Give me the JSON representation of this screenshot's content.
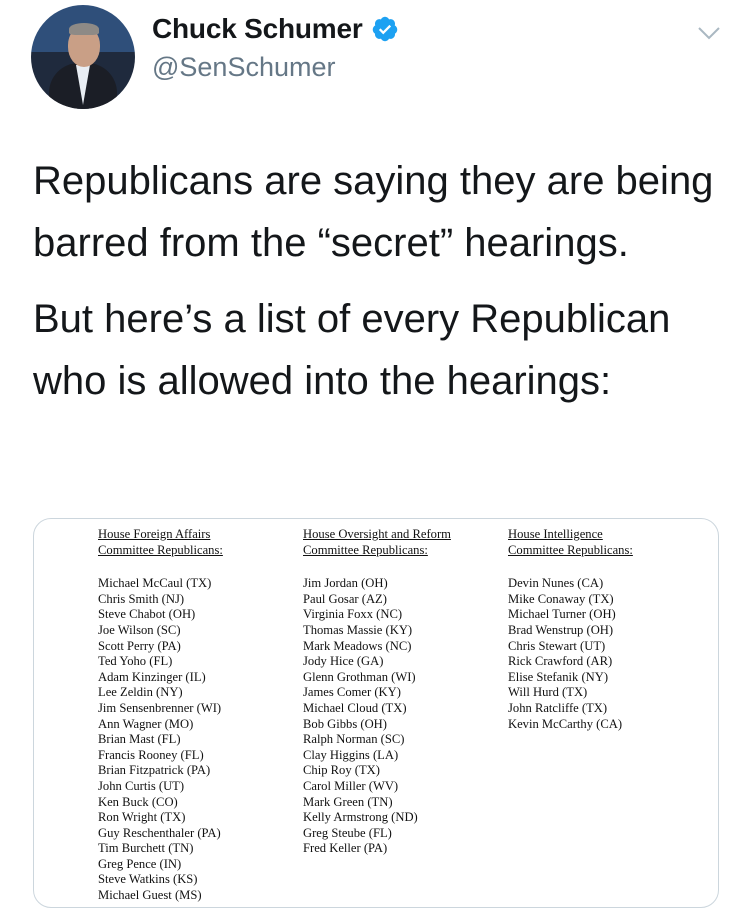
{
  "header": {
    "display_name": "Chuck Schumer",
    "handle": "@SenSchumer",
    "verified_icon": "verified-badge-icon",
    "more_icon": "chevron-down-icon",
    "accent_color": "#1da1f2"
  },
  "tweet": {
    "paragraph1": "Republicans are saying they are being barred from the “secret” hearings.",
    "paragraph2": "But here’s a list of every Republican who is allowed into the hearings:"
  },
  "image": {
    "columns": [
      {
        "header_line1": "House Foreign Affairs",
        "header_line2": "Committee Republicans:",
        "names": [
          "Michael McCaul (TX)",
          "Chris Smith (NJ)",
          "Steve Chabot (OH)",
          "Joe Wilson (SC)",
          "Scott Perry (PA)",
          "Ted Yoho (FL)",
          "Adam Kinzinger (IL)",
          "Lee Zeldin (NY)",
          "Jim Sensenbrenner (WI)",
          "Ann Wagner (MO)",
          "Brian Mast (FL)",
          "Francis Rooney (FL)",
          "Brian Fitzpatrick (PA)",
          "John Curtis (UT)",
          "Ken Buck (CO)",
          "Ron Wright (TX)",
          "Guy Reschenthaler (PA)",
          "Tim Burchett (TN)",
          "Greg Pence (IN)",
          "Steve Watkins (KS)",
          "Michael Guest (MS)"
        ]
      },
      {
        "header_line1": "House Oversight and Reform",
        "header_line2": "Committee Republicans:",
        "names": [
          "Jim Jordan (OH)",
          "Paul Gosar (AZ)",
          "Virginia Foxx (NC)",
          "Thomas Massie (KY)",
          "Mark Meadows (NC)",
          "Jody Hice (GA)",
          "Glenn Grothman (WI)",
          "James Comer (KY)",
          "Michael Cloud (TX)",
          "Bob Gibbs (OH)",
          "Ralph Norman (SC)",
          "Clay Higgins (LA)",
          "Chip Roy (TX)",
          "Carol Miller (WV)",
          "Mark Green (TN)",
          "Kelly Armstrong (ND)",
          "Greg Steube (FL)",
          "Fred Keller (PA)"
        ]
      },
      {
        "header_line1": "House Intelligence",
        "header_line2": "Committee Republicans:",
        "names": [
          "Devin Nunes (CA)",
          "Mike Conaway (TX)",
          "Michael Turner (OH)",
          "Brad Wenstrup (OH)",
          "Chris Stewart (UT)",
          "Rick Crawford (AR)",
          "Elise Stefanik (NY)",
          "Will Hurd (TX)",
          "John Ratcliffe (TX)",
          "Kevin McCarthy (CA)"
        ]
      }
    ]
  }
}
